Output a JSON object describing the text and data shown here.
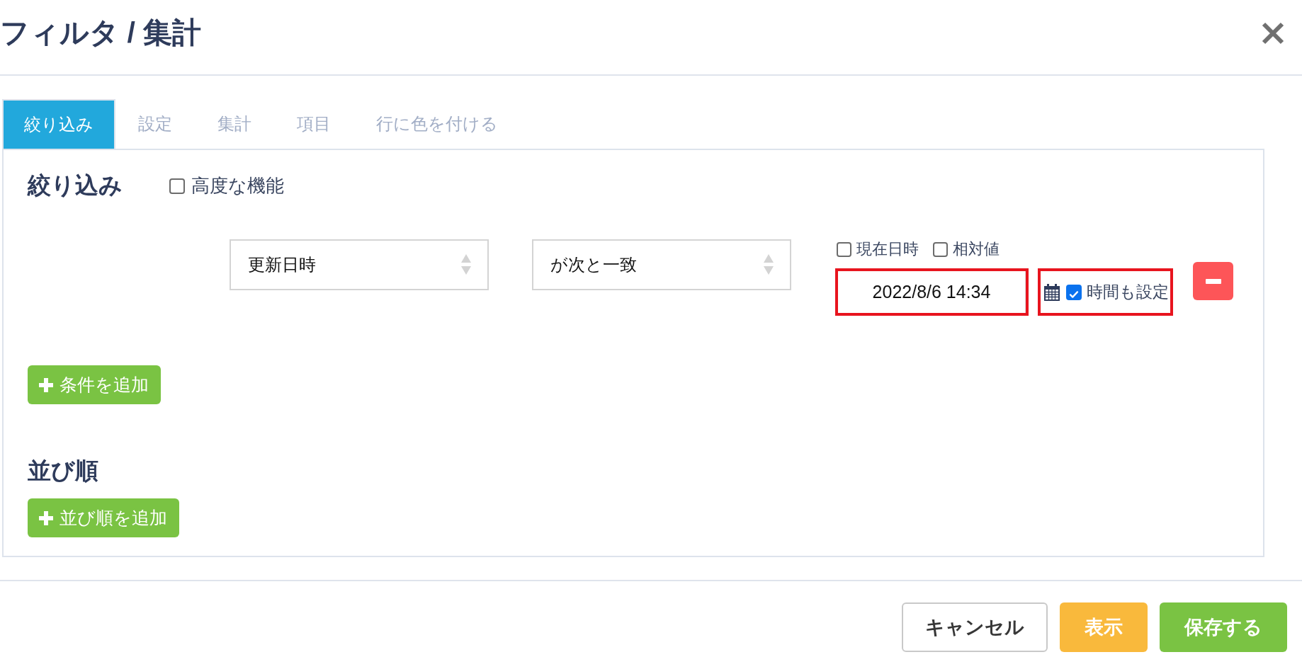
{
  "dialog": {
    "title": "フィルタ / 集計"
  },
  "tabs": [
    {
      "label": "絞り込み",
      "selected": true
    },
    {
      "label": "設定",
      "selected": false
    },
    {
      "label": "集計",
      "selected": false
    },
    {
      "label": "項目",
      "selected": false
    },
    {
      "label": "行に色を付ける",
      "selected": false
    }
  ],
  "filter_section": {
    "heading": "絞り込み",
    "advanced": {
      "label": "高度な機能",
      "checked": false
    },
    "conditions": [
      {
        "field": "更新日時",
        "operator": "が次と一致",
        "options": [
          {
            "label": "現在日時",
            "checked": false
          },
          {
            "label": "相対値",
            "checked": false
          }
        ],
        "value": "2022/8/6 14:34",
        "value_highlighted": true,
        "time": {
          "label": "時間も設定",
          "checked": true,
          "highlighted": true
        }
      }
    ],
    "add_button": "条件を追加"
  },
  "sort_section": {
    "heading": "並び順",
    "add_button": "並び順を追加"
  },
  "footer_buttons": [
    {
      "label": "キャンセル",
      "kind": "default"
    },
    {
      "label": "表示",
      "kind": "warning"
    },
    {
      "label": "保存する",
      "kind": "success"
    }
  ]
}
